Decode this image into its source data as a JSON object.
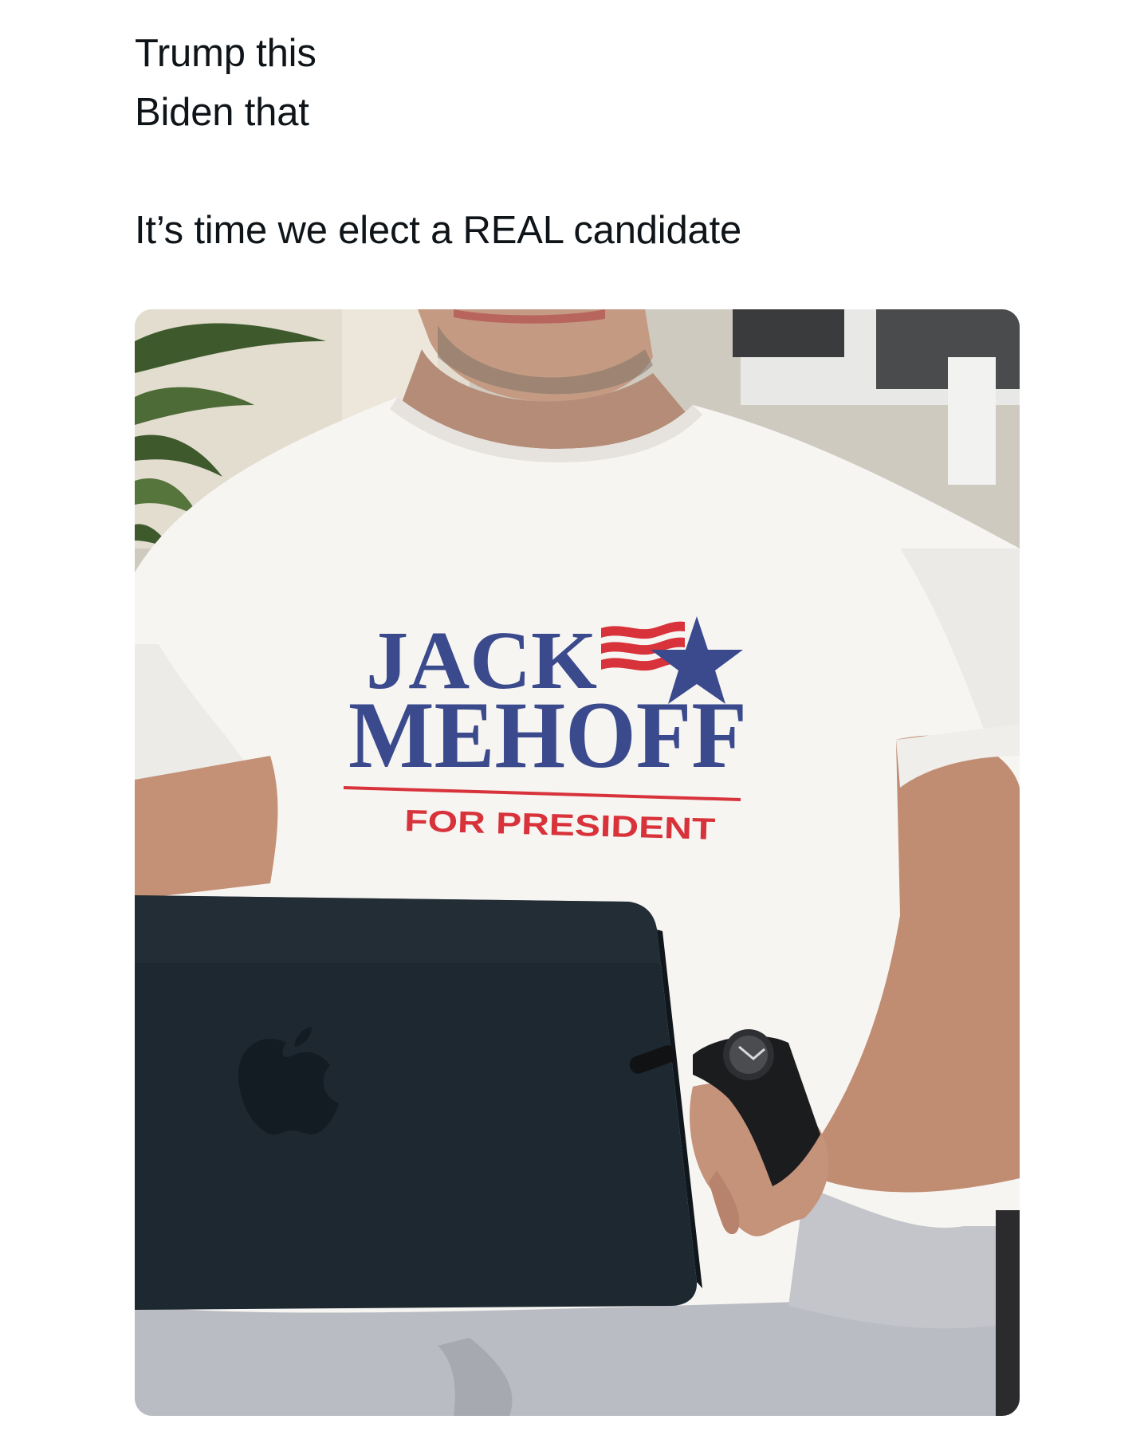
{
  "post": {
    "line1": "Trump this",
    "line2": "Biden that",
    "line3": "It’s time we elect a REAL candidate"
  },
  "photo": {
    "shirt_line1": "JACK",
    "shirt_line2": "MEHOFF",
    "shirt_line3": "FOR PRESIDENT"
  },
  "colors": {
    "text": "#0f1419",
    "shirt_blue": "#3b4a8c",
    "shirt_red": "#d8323a",
    "background": "#ffffff"
  }
}
